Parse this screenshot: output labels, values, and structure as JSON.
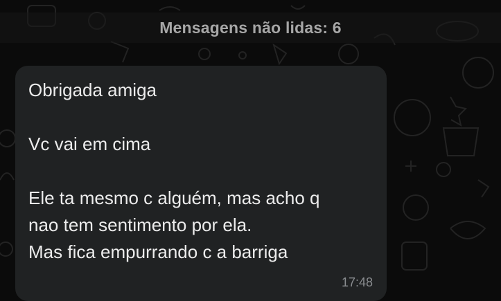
{
  "banner": {
    "label": "Mensagens não lidas: 6"
  },
  "message": {
    "lines": [
      "Obrigada amiga",
      "",
      "Vc vai em cima",
      "",
      "Ele ta mesmo c alguém, mas acho q",
      "nao tem sentimento por ela.",
      "Mas fica empurrando c a barriga"
    ],
    "time": "17:48"
  },
  "colors": {
    "background": "#0b0b0b",
    "bubble": "#202223",
    "text": "#ececec",
    "muted": "#8a8d90"
  },
  "icons": [
    "chat-wallpaper-doodle-pattern"
  ]
}
